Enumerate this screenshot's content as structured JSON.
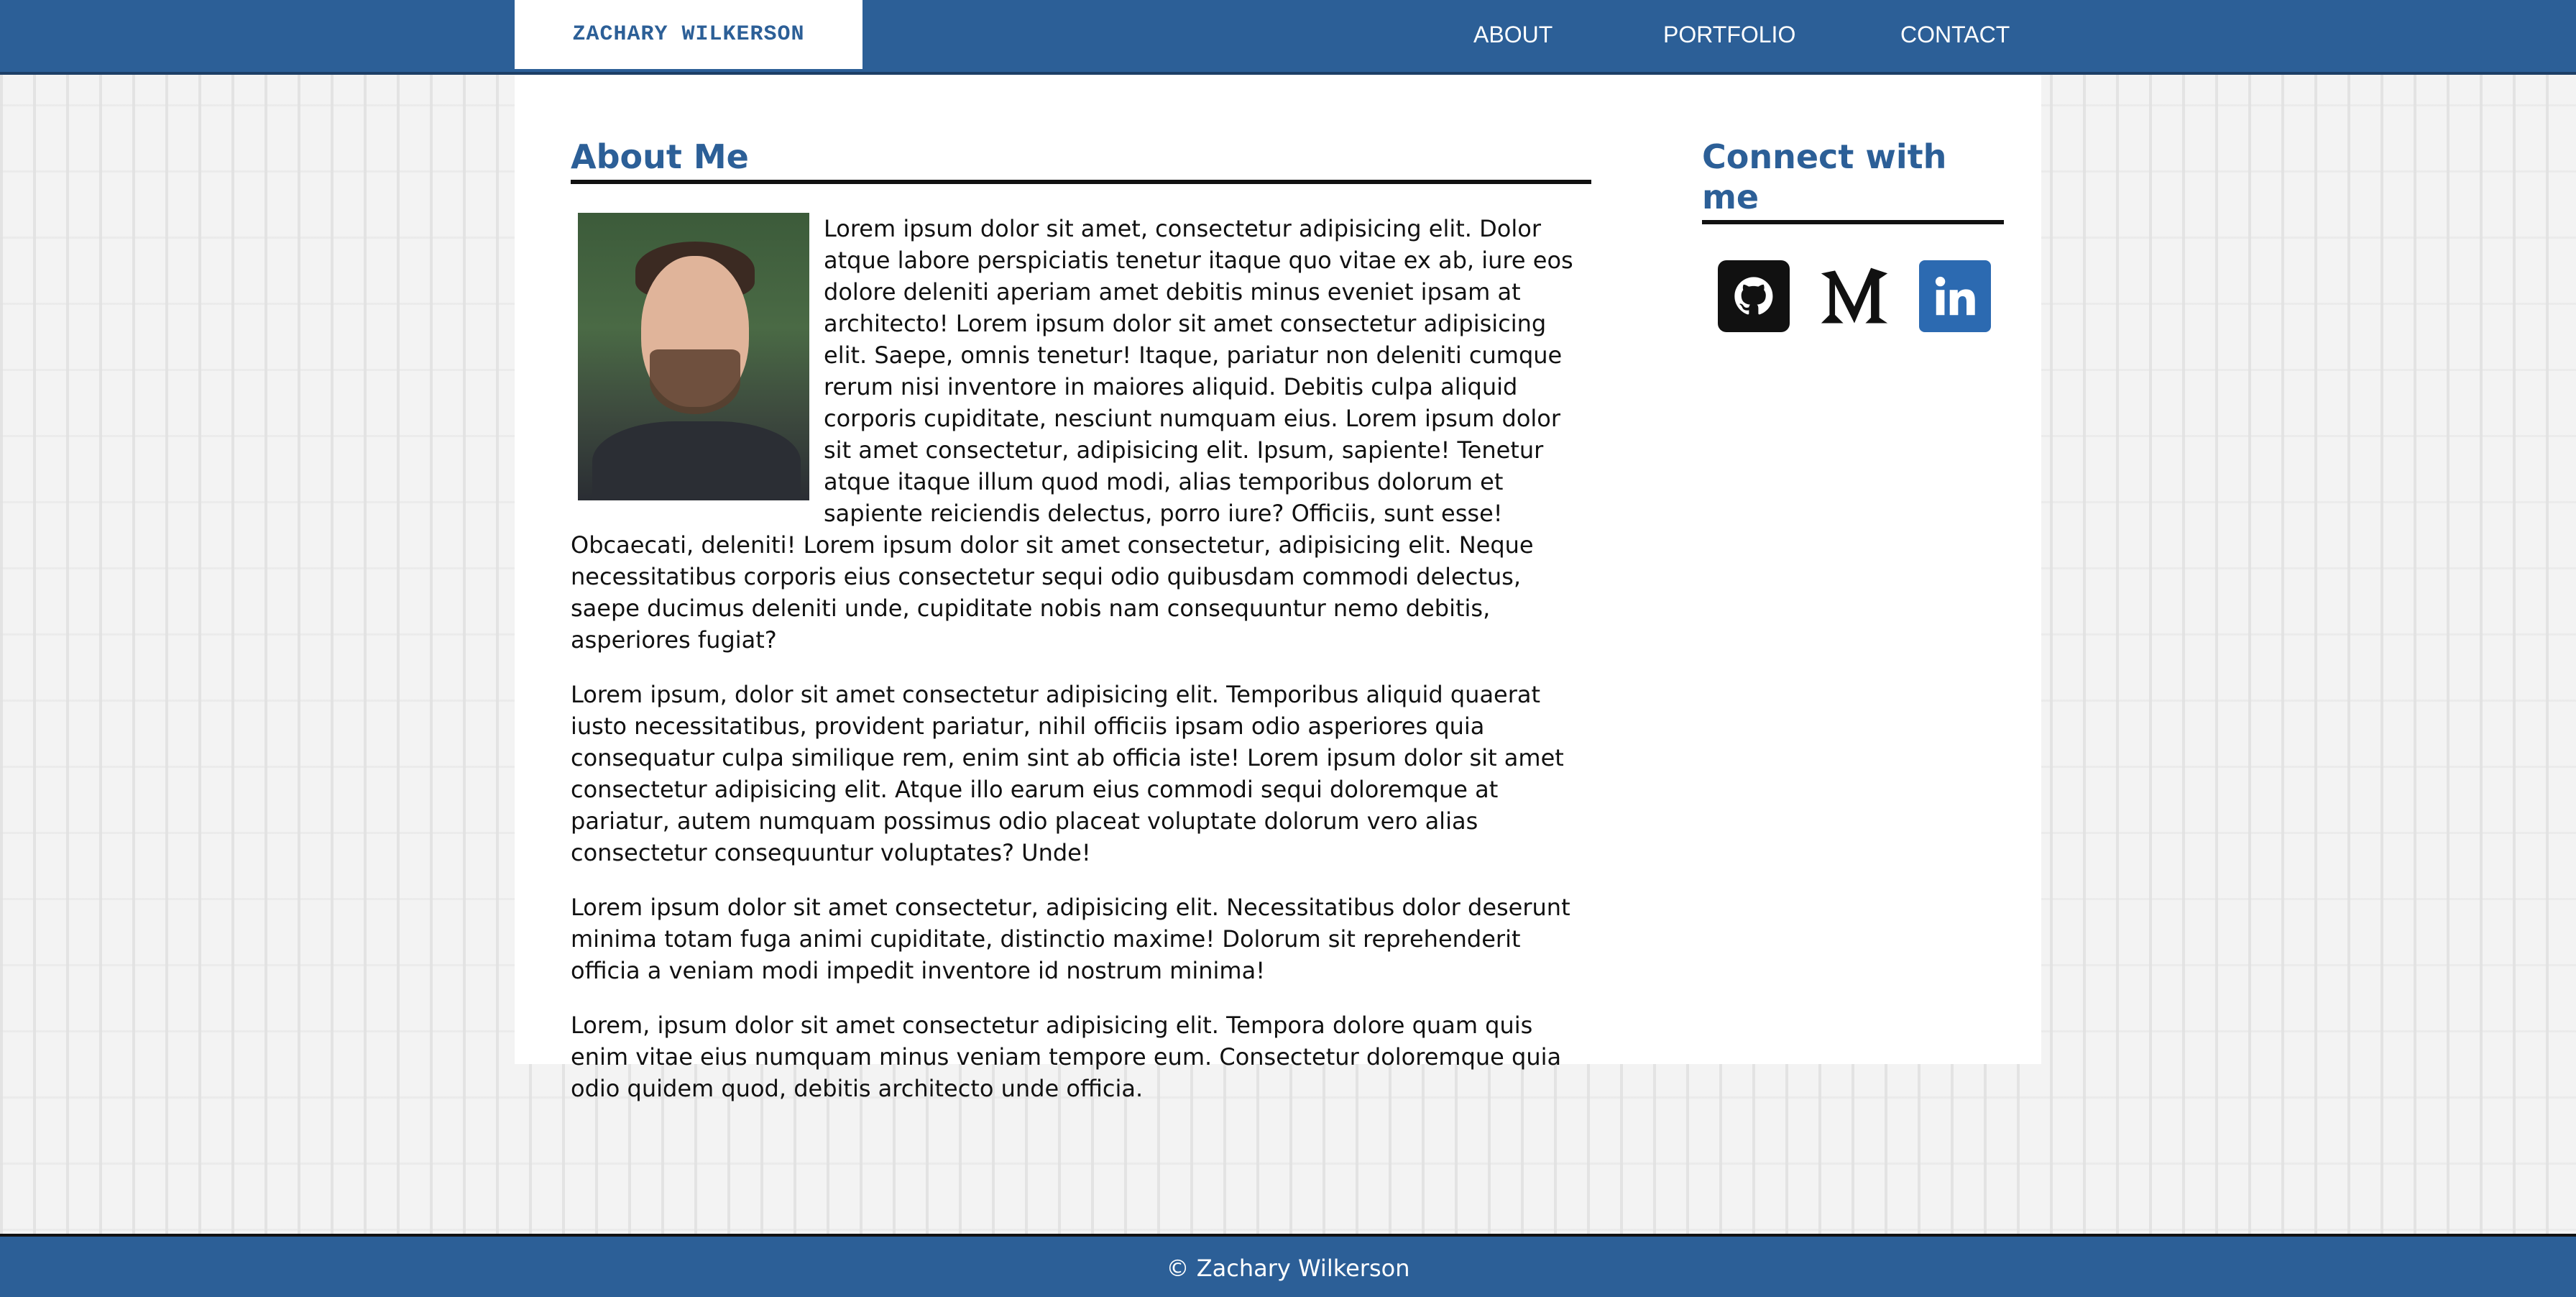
{
  "header": {
    "brand": "ZACHARY WILKERSON",
    "nav": [
      "ABOUT",
      "PORTFOLIO",
      "CONTACT"
    ]
  },
  "about": {
    "title": "About Me",
    "paragraphs": [
      "Lorem ipsum dolor sit amet, consectetur adipisicing elit. Dolor atque labore perspiciatis tenetur itaque quo vitae ex ab, iure eos dolore deleniti aperiam amet debitis minus eveniet ipsam at architecto! Lorem ipsum dolor sit amet consectetur adipisicing elit. Saepe, omnis tenetur! Itaque, pariatur non deleniti cumque rerum nisi inventore in maiores aliquid. Debitis culpa aliquid corporis cupiditate, nesciunt numquam eius. Lorem ipsum dolor sit amet consectetur, adipisicing elit. Ipsum, sapiente! Tenetur atque itaque illum quod modi, alias temporibus dolorum et sapiente reiciendis delectus, porro iure? Officiis, sunt esse! Obcaecati, deleniti! Lorem ipsum dolor sit amet consectetur, adipisicing elit. Neque necessitatibus corporis eius consectetur sequi odio quibusdam commodi delectus, saepe ducimus deleniti unde, cupiditate nobis nam consequuntur nemo debitis, asperiores fugiat?",
      "Lorem ipsum, dolor sit amet consectetur adipisicing elit. Temporibus aliquid quaerat iusto necessitatibus, provident pariatur, nihil officiis ipsam odio asperiores quia consequatur culpa similique rem, enim sint ab officia iste! Lorem ipsum dolor sit amet consectetur adipisicing elit. Atque illo earum eius commodi sequi doloremque at pariatur, autem numquam possimus odio placeat voluptate dolorum vero alias consectetur consequuntur voluptates? Unde!",
      "Lorem ipsum dolor sit amet consectetur, adipisicing elit. Necessitatibus dolor deserunt minima totam fuga animi cupiditate, distinctio maxime! Dolorum sit reprehenderit officia a veniam modi impedit inventore id nostrum minima!",
      "Lorem, ipsum dolor sit amet consectetur adipisicing elit. Tempora dolore quam quis enim vitae eius numquam minus veniam tempore eum. Consectetur doloremque quia odio quidem quod, debitis architecto unde officia."
    ]
  },
  "connect": {
    "title": "Connect with me",
    "icons": [
      "github-icon",
      "medium-icon",
      "linkedin-icon"
    ]
  },
  "footer": {
    "text": "© Zachary Wilkerson"
  },
  "colors": {
    "primary": "#2c5f97",
    "linkedin": "#2c6ab1",
    "text": "#111111"
  }
}
